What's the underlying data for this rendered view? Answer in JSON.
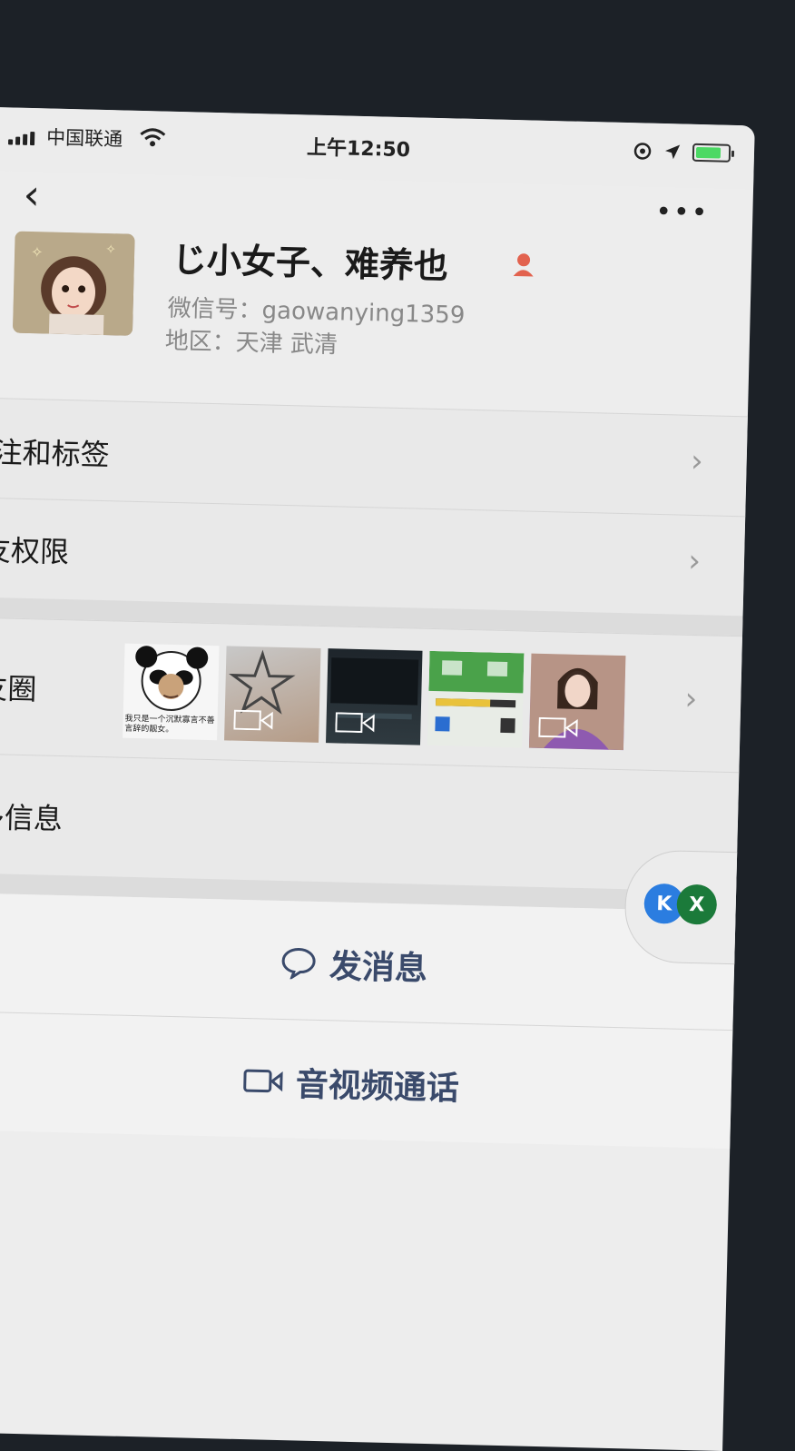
{
  "status_bar": {
    "carrier": "中国联通",
    "time": "上午12:50"
  },
  "nav": {
    "back_label": "‹",
    "more_label": "•••"
  },
  "profile": {
    "name": "じ小女子、难养也",
    "wechat_id": "微信号：gaowanying1359",
    "region": "地区：天津 武清"
  },
  "rows": {
    "remarks_tags": "备注和标签",
    "friend_permissions": "朋友权限",
    "moments": "朋友圈",
    "more_info": "更多信息"
  },
  "moments_thumbs": [
    {
      "kind": "meme",
      "caption": "我只是一个沉默寡言不善言辞的靓女。"
    },
    {
      "kind": "video"
    },
    {
      "kind": "video"
    },
    {
      "kind": "image"
    },
    {
      "kind": "video"
    }
  ],
  "actions": {
    "send_message": "发消息",
    "av_call": "音视频通话"
  },
  "floating": {
    "left_badge": "K",
    "right_badge": "X"
  },
  "colors": {
    "action_text": "#3a4a6b",
    "gender_icon": "#e2624e"
  }
}
